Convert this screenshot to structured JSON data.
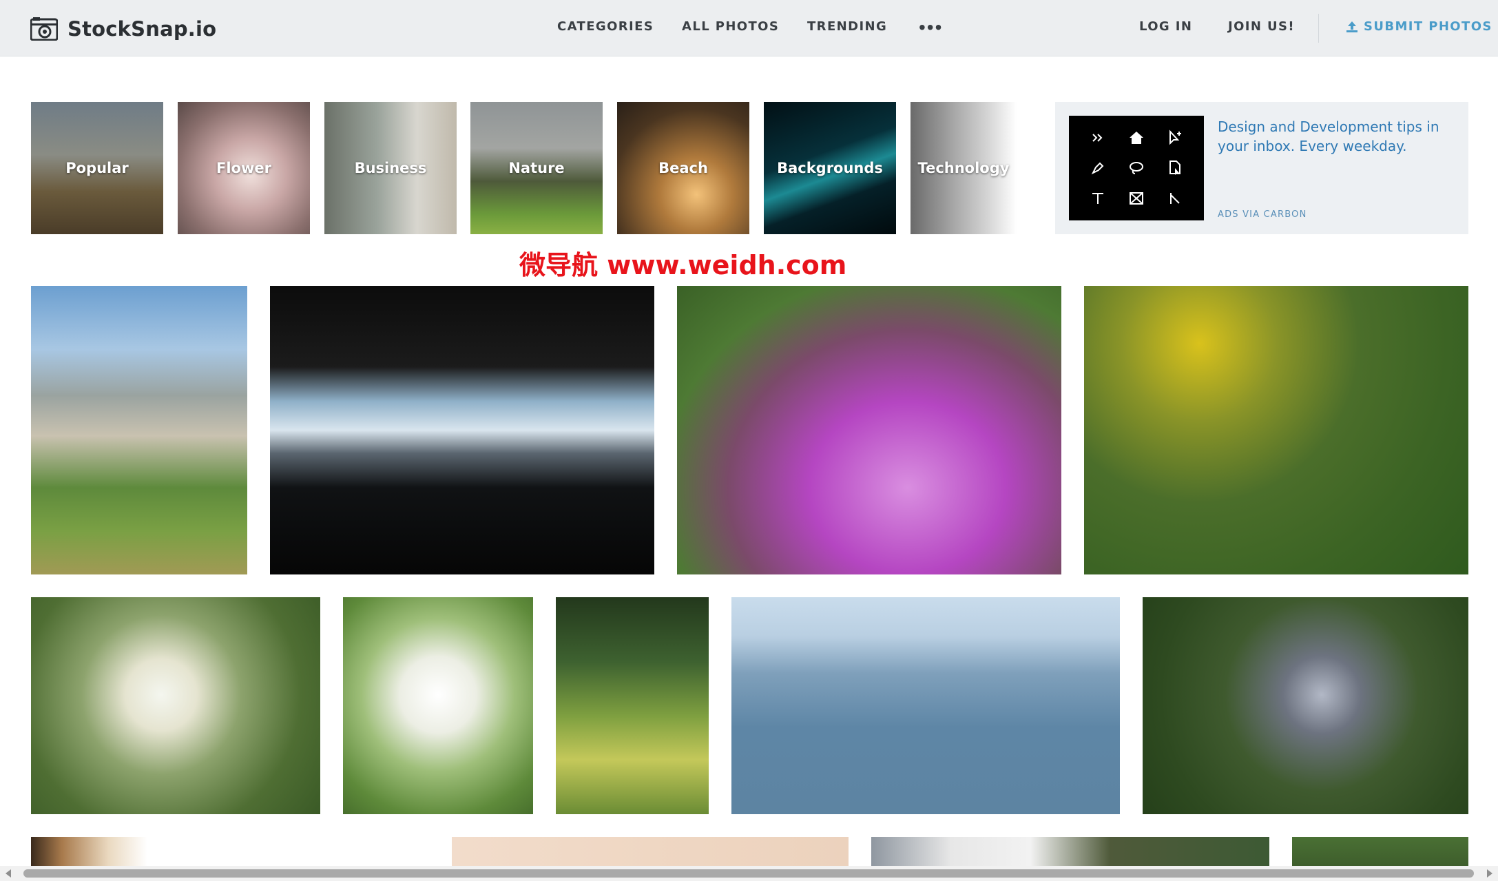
{
  "header": {
    "logo_text": "StockSnap.io",
    "nav": [
      {
        "label": "CATEGORIES"
      },
      {
        "label": "ALL PHOTOS"
      },
      {
        "label": "TRENDING"
      }
    ],
    "more_label": "•••",
    "login_label": "LOG IN",
    "join_label": "JOIN US!",
    "submit_label": "SUBMIT PHOTOS",
    "accent_color": "#4a9cc9"
  },
  "categories": [
    {
      "label": "Popular"
    },
    {
      "label": "Flower"
    },
    {
      "label": "Business"
    },
    {
      "label": "Nature"
    },
    {
      "label": "Beach"
    },
    {
      "label": "Backgrounds"
    },
    {
      "label": "Technology"
    }
  ],
  "ad": {
    "text": "Design and Development tips in your inbox. Every weekday.",
    "via": "ADS VIA CARBON"
  },
  "watermark": "微导航 www.weidh.com"
}
